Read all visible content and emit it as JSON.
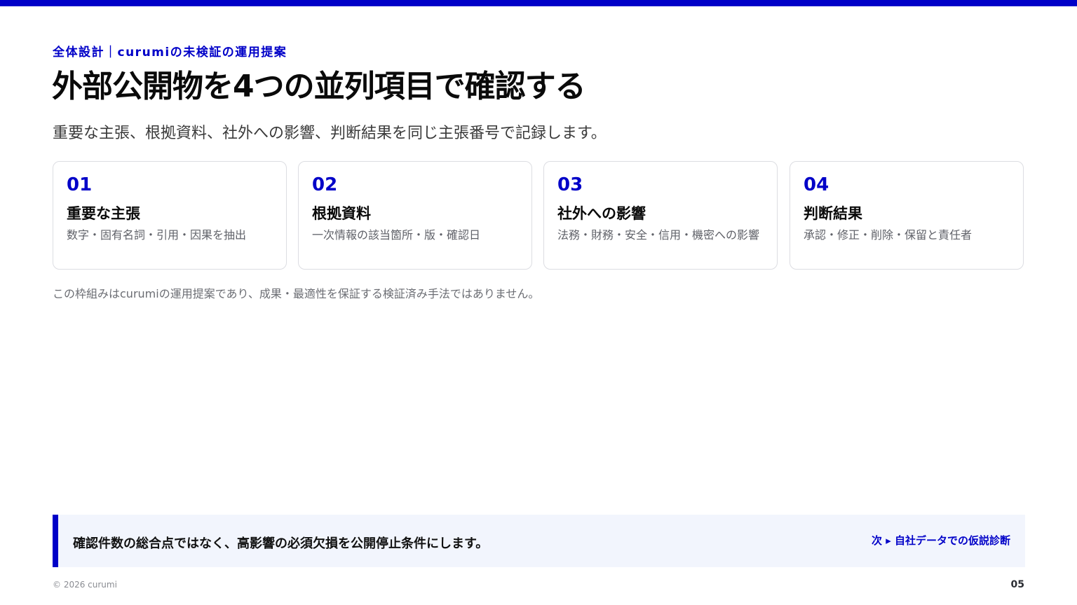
{
  "colors": {
    "accent": "#0000c8",
    "callout_bg": "#f2f5fd"
  },
  "header": {
    "eyebrow": "全体設計｜curumiの未検証の運用提案",
    "title": "外部公開物を4つの並列項目で確認する",
    "subtitle": "重要な主張、根拠資料、社外への影響、判断結果を同じ主張番号で記録します。"
  },
  "cards": [
    {
      "number": "01",
      "title": "重要な主張",
      "desc": "数字・固有名詞・引用・因果を抽出"
    },
    {
      "number": "02",
      "title": "根拠資料",
      "desc": "一次情報の該当箇所・版・確認日"
    },
    {
      "number": "03",
      "title": "社外への影響",
      "desc": "法務・財務・安全・信用・機密への影響"
    },
    {
      "number": "04",
      "title": "判断結果",
      "desc": "承認・修正・削除・保留と責任者"
    }
  ],
  "note": "この枠組みはcurumiの運用提案であり、成果・最適性を保証する検証済み手法ではありません。",
  "callout": {
    "text": "確認件数の総合点ではなく、高影響の必須欠損を公開停止条件にします。",
    "next": "次 ▸ 自社データでの仮説診断"
  },
  "footer": {
    "copyright": "© 2026 curumi",
    "page": "05"
  }
}
